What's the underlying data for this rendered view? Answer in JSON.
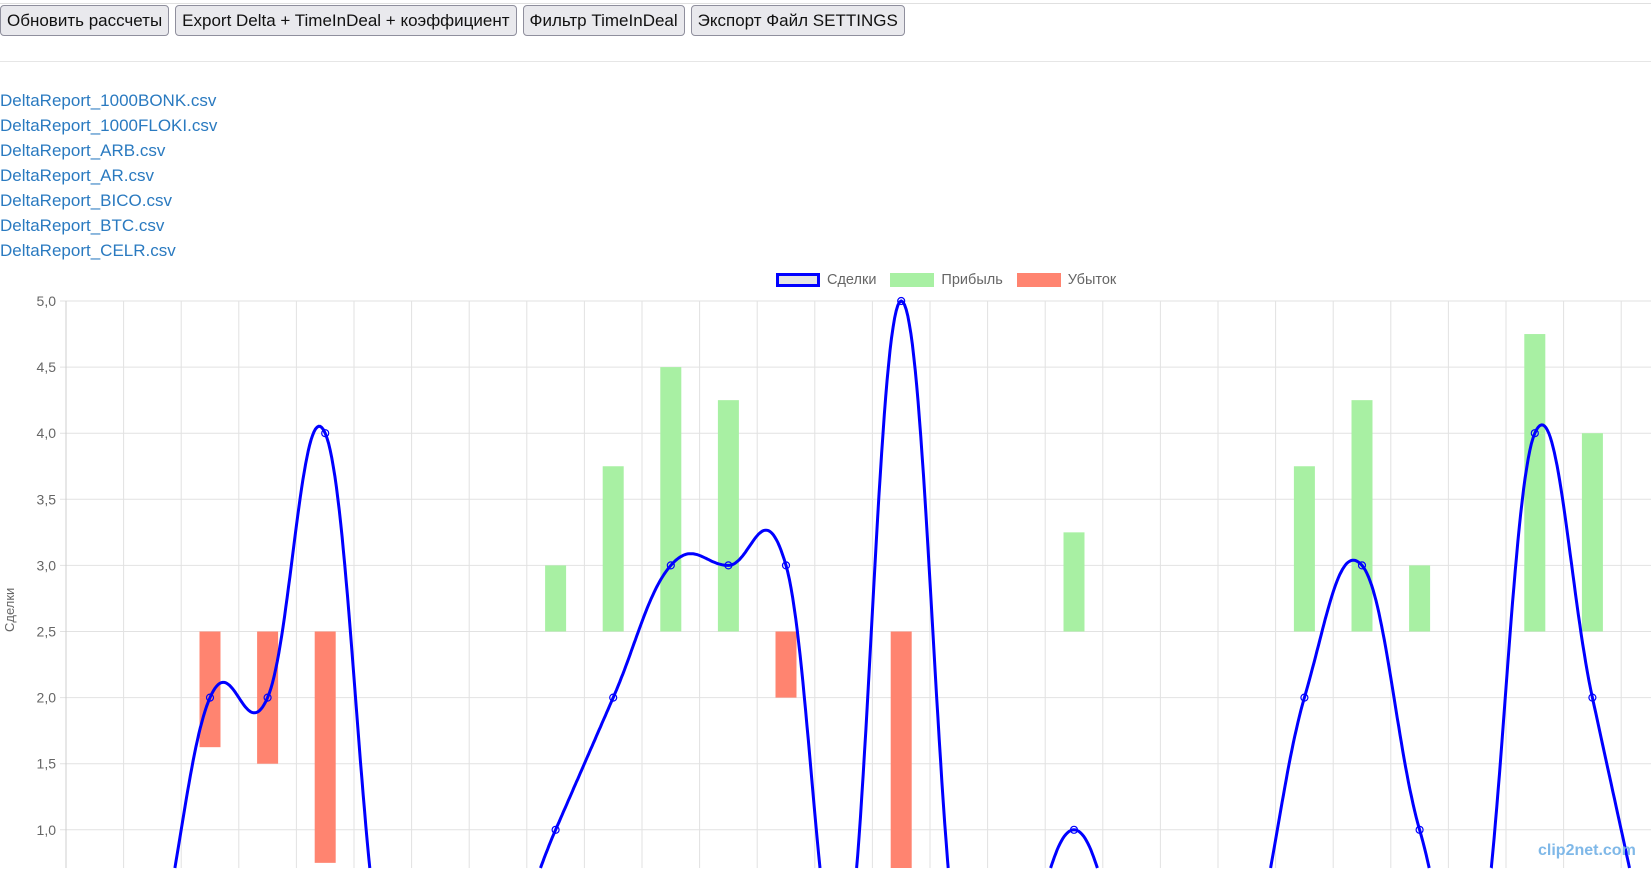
{
  "toolbar": {
    "buttons": [
      "Обновить рассчеты",
      "Export Delta + TimeInDeal + коэффициент",
      "Фильтр TimeInDeal",
      "Экспорт Файл SETTINGS"
    ]
  },
  "files": [
    "DeltaReport_1000BONK.csv",
    "DeltaReport_1000FLOKI.csv",
    "DeltaReport_ARB.csv",
    "DeltaReport_AR.csv",
    "DeltaReport_BICO.csv",
    "DeltaReport_BTC.csv",
    "DeltaReport_CELR.csv"
  ],
  "watermark": "clip2net.com",
  "chart_data": {
    "type": "bar+line",
    "ylabel": "Сделки",
    "ylim": [
      0.7,
      5.0
    ],
    "yticks": [
      "5,0",
      "4,5",
      "4,0",
      "3,5",
      "3,0",
      "2,5",
      "2,0",
      "1,5",
      "1,0"
    ],
    "ytick_values": [
      5,
      4.5,
      4,
      3.5,
      3,
      2.5,
      2,
      1.5,
      1
    ],
    "category_count": 28,
    "legend": [
      {
        "label": "Сделки",
        "color": "#0000ff",
        "fill": "#e4e4e4"
      },
      {
        "label": "Прибыль",
        "color": "#a8f0a3"
      },
      {
        "label": "Убыток",
        "color": "#ff8470"
      }
    ],
    "series": [
      {
        "name": "Сделки",
        "type": "line",
        "values": [
          0,
          0,
          2,
          2,
          4,
          0,
          0,
          0,
          1,
          2,
          3,
          3,
          3,
          0,
          5,
          0,
          0,
          1,
          0,
          0,
          0,
          2,
          3,
          1,
          0,
          4,
          2,
          0
        ]
      },
      {
        "name": "Прибыль",
        "type": "floating-bar",
        "ranges": {
          "8": [
            2.5,
            3.0
          ],
          "9": [
            2.5,
            3.75
          ],
          "10": [
            2.5,
            4.5
          ],
          "11": [
            2.5,
            4.25
          ],
          "17": [
            2.5,
            3.25
          ],
          "21": [
            2.5,
            3.75
          ],
          "22": [
            2.5,
            4.25
          ],
          "23": [
            2.5,
            3.0
          ],
          "25": [
            2.5,
            4.75
          ],
          "26": [
            2.5,
            4.0
          ]
        }
      },
      {
        "name": "Убыток",
        "type": "floating-bar",
        "ranges": {
          "2": [
            1.625,
            2.5
          ],
          "3": [
            1.5,
            2.5
          ],
          "4": [
            0.75,
            2.5
          ],
          "12": [
            2.0,
            2.5
          ],
          "14": [
            0.5,
            2.5
          ]
        }
      }
    ]
  }
}
